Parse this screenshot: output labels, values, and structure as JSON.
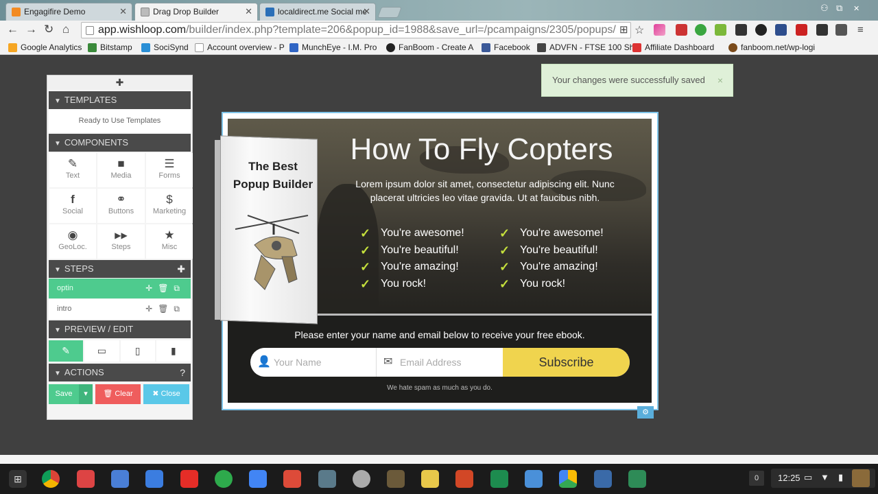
{
  "browser": {
    "tabs": [
      {
        "title": "Engagifire Demo",
        "color": "#f28b22",
        "active": false
      },
      {
        "title": "Drag Drop Builder",
        "color": "#999999",
        "active": true
      },
      {
        "title": "localdirect.me Social me",
        "color": "#2a6fb8",
        "active": false
      }
    ],
    "url_host": "app.wishloop.com",
    "url_path": "/builder/index.php?template=206&popup_id=1988&save_url=/pcampaigns/2305/popups/",
    "bookmarks": [
      "Google Analytics",
      "Bitstamp",
      "SociSynd",
      "Account overview - P",
      "MunchEye - I.M. Pro",
      "FanBoom - Create A",
      "Facebook",
      "ADVFN - FTSE 100 Sh",
      "Affiliate Dashboard",
      "fanboom.net/wp-logi"
    ]
  },
  "sidebar": {
    "drag_icon": "move-icon",
    "templates_header": "TEMPLATES",
    "templates_sub": "Ready to Use Templates",
    "components_header": "COMPONENTS",
    "components": [
      {
        "label": "Text",
        "icon": "✎"
      },
      {
        "label": "Media",
        "icon": "■"
      },
      {
        "label": "Forms",
        "icon": "☰"
      },
      {
        "label": "Social",
        "icon": "f"
      },
      {
        "label": "Buttons",
        "icon": "⚭"
      },
      {
        "label": "Marketing",
        "icon": "$"
      },
      {
        "label": "GeoLoc.",
        "icon": "◉"
      },
      {
        "label": "Steps",
        "icon": "▶▶"
      },
      {
        "label": "Misc",
        "icon": "★"
      }
    ],
    "steps_header": "STEPS",
    "steps": [
      {
        "label": "optin",
        "active": true
      },
      {
        "label": "intro",
        "active": false
      }
    ],
    "preview_header": "PREVIEW / EDIT",
    "actions_header": "ACTIONS",
    "actions_help": "?",
    "save_label": "Save",
    "clear_label": "Clear",
    "close_label": "Close"
  },
  "toast": {
    "message": "Your changes were successfully saved",
    "close": "×"
  },
  "popup": {
    "book_title": "The Best Popup Builder",
    "title": "How To Fly Copters",
    "subtitle": "Lorem ipsum dolor sit amet, consectetur adipiscing elit. Nunc placerat ultricies leo vitae gravida. Ut at faucibus nibh.",
    "checks_left": [
      "You're awesome!",
      "You're beautiful!",
      "You're amazing!",
      "You rock!"
    ],
    "checks_right": [
      "You're awesome!",
      "You're beautiful!",
      "You're amazing!",
      "You rock!"
    ],
    "cta": "Please enter your name and email below to receive your free ebook.",
    "name_placeholder": "Your Name",
    "email_placeholder": "Email Address",
    "subscribe_label": "Subscribe",
    "spam_note": "We hate spam as much as you do.",
    "accent_color": "#f0d44e",
    "check_color": "#c5e03c"
  },
  "taskbar": {
    "notification_count": "0",
    "time": "12:25"
  }
}
